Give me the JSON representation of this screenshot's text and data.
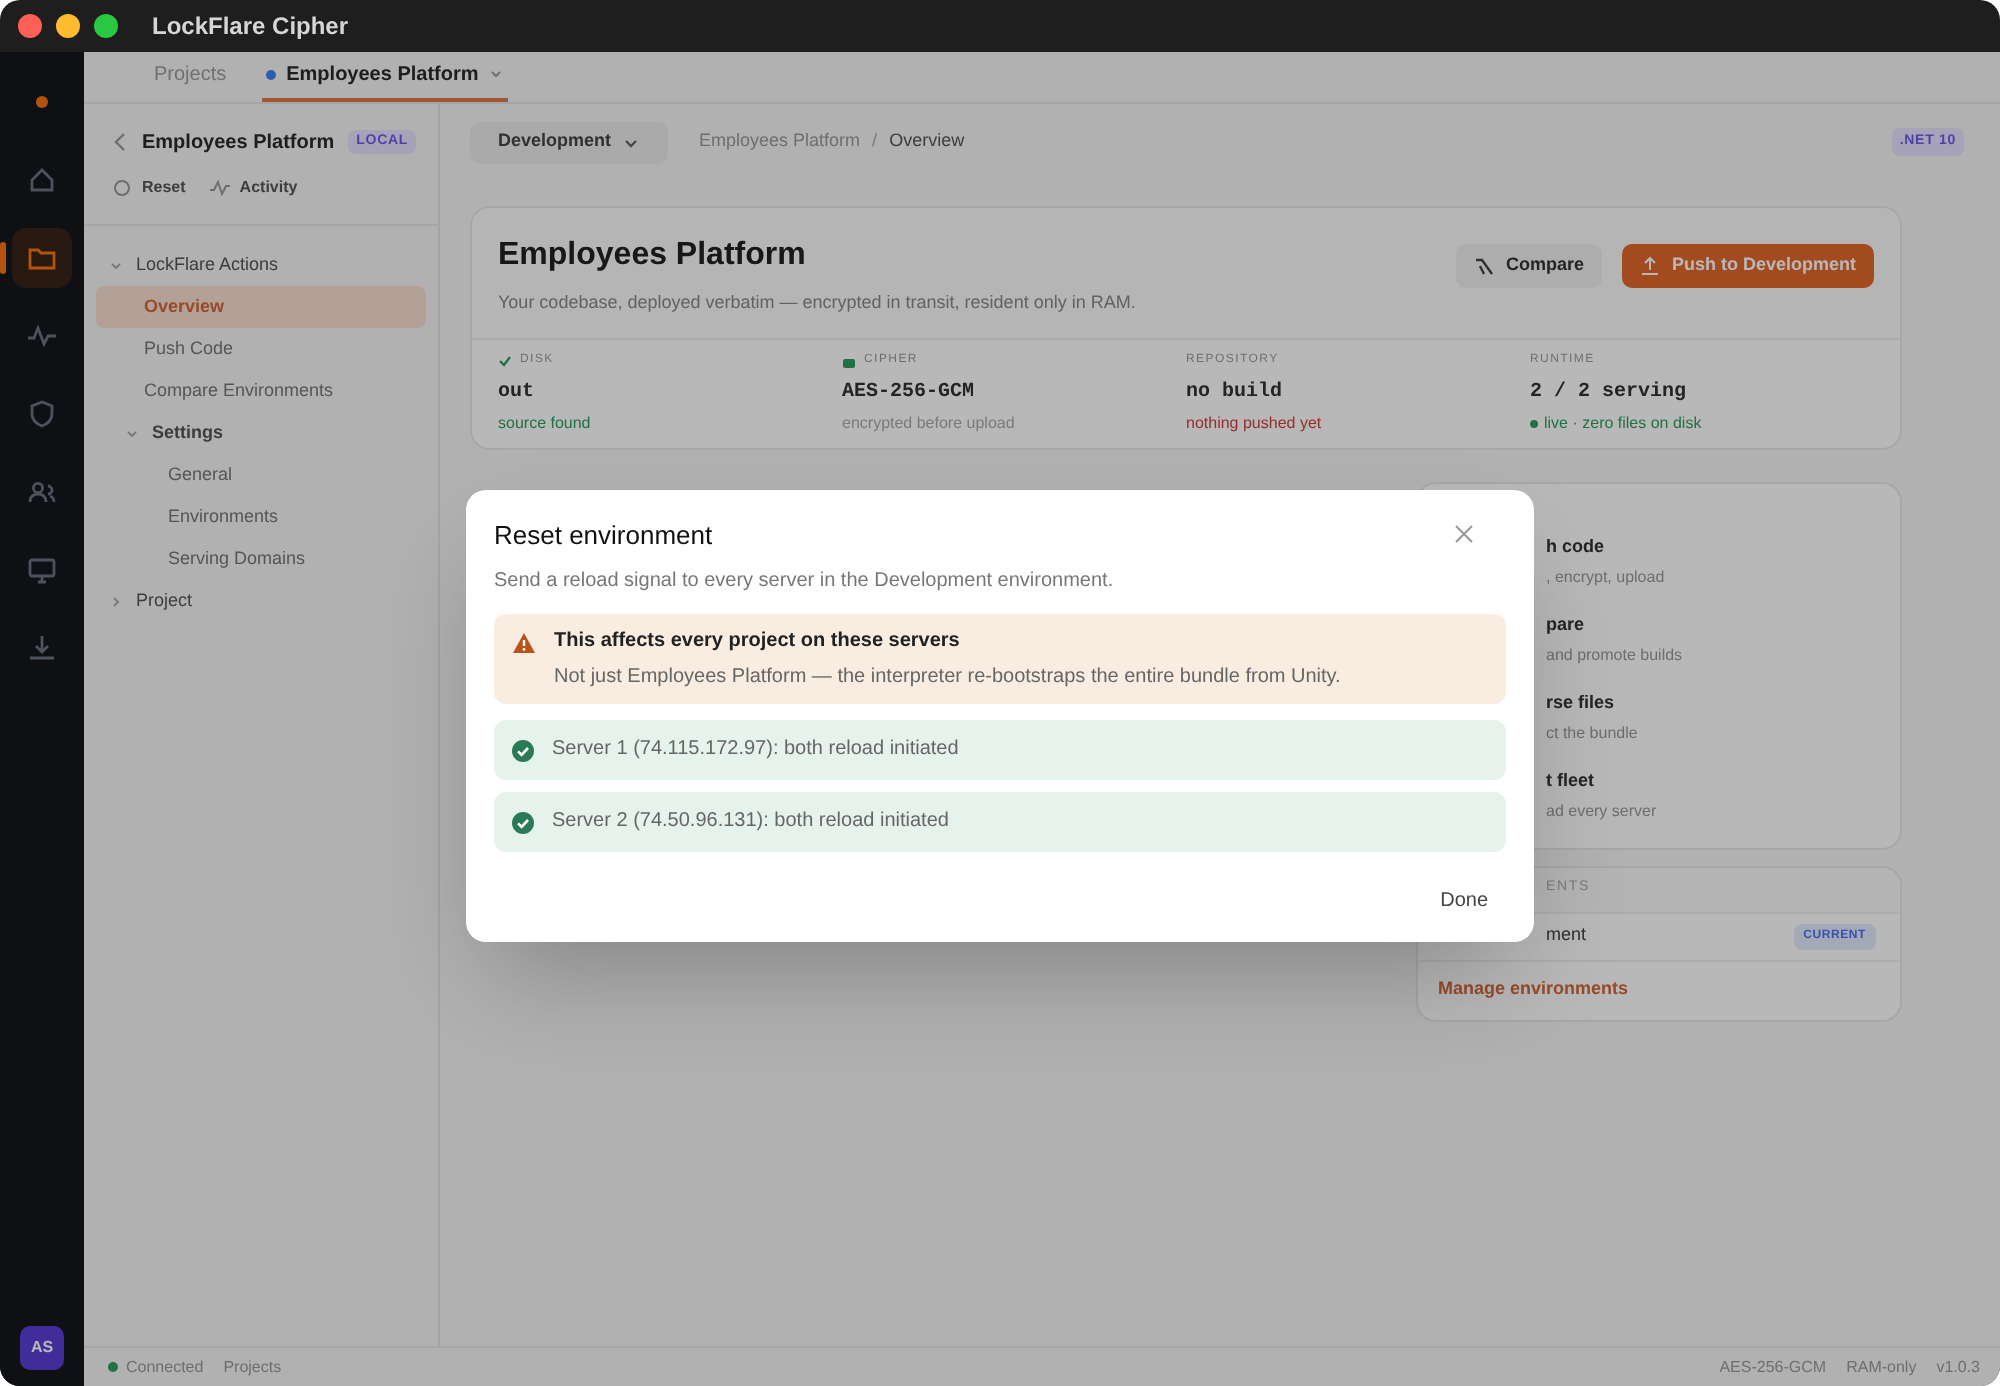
{
  "window": {
    "title": "LockFlare Cipher"
  },
  "rail_items": [
    {
      "selected": false
    },
    {
      "selected": false
    },
    {
      "selected": true
    },
    {
      "selected": false
    },
    {
      "selected": false
    },
    {
      "selected": false
    },
    {
      "selected": false
    },
    {
      "selected": false
    }
  ],
  "avatar": "AS",
  "tabs": [
    {
      "label": "Projects",
      "selected": false
    },
    {
      "label": "Employees Platform",
      "selected": true
    }
  ],
  "sidebar": {
    "title": "Employees Platform",
    "badge": "LOCAL",
    "actions": [
      "Reset",
      "Activity"
    ],
    "tree": [
      {
        "label": "LockFlare Actions",
        "expanded": true,
        "children": [
          {
            "label": "Overview",
            "selected": true
          },
          {
            "label": "Push Code",
            "selected": false
          },
          {
            "label": "Compare Environments",
            "selected": false
          },
          {
            "label": "Settings",
            "expanded": true,
            "children": [
              {
                "label": "General",
                "selected": false
              },
              {
                "label": "Environments",
                "selected": false
              },
              {
                "label": "Serving Domains",
                "selected": false
              }
            ]
          }
        ]
      },
      {
        "label": "Project",
        "expanded": false
      }
    ]
  },
  "topbar": {
    "environment": "Development",
    "breadcrumb": [
      "Employees Platform",
      "Overview"
    ],
    "breadcrumb_separator": "/",
    "badge": ".NET 10"
  },
  "header": {
    "title": "Employees Platform",
    "subtitle": "Your codebase, deployed verbatim — encrypted in transit, resident only in RAM.",
    "buttons": [
      {
        "label": "Compare",
        "kind": "secondary"
      },
      {
        "label": "Push to Development",
        "kind": "primary"
      }
    ]
  },
  "stats": [
    {
      "label": "DISK",
      "value": "out",
      "note": "source found",
      "kind": "found"
    },
    {
      "label": "CIPHER",
      "value": "AES-256-GCM",
      "note": "encrypted before upload",
      "kind": "encrypted"
    },
    {
      "label": "REPOSITORY",
      "value": "no build",
      "note": "nothing pushed yet",
      "kind": "missing"
    },
    {
      "label": "RUNTIME",
      "value": "2 / 2 serving",
      "note": "live · zero files on disk",
      "kind": "live"
    }
  ],
  "actions_panel": [
    {
      "title": "h code",
      "note": ", encrypt, upload"
    },
    {
      "title": "pare",
      "note": "and promote builds"
    },
    {
      "title": "rse files",
      "note": "ct the bundle"
    },
    {
      "title": "t fleet",
      "note": "ad every server"
    }
  ],
  "environments_panel": {
    "header": "ENTS",
    "rows": [
      {
        "name": "ment",
        "badge": "CURRENT"
      }
    ],
    "link": "Manage environments"
  },
  "status_bar": {
    "connection": "Connected",
    "connected": true,
    "left": [
      "Projects"
    ],
    "right": [
      "AES-256-GCM",
      "RAM-only",
      "v1.0.3"
    ]
  },
  "dialog": {
    "title": "Reset environment",
    "description": "Send a reload signal to every server in the Development environment.",
    "warning": {
      "title": "This affects every project on these servers",
      "body": "Not just Employees Platform — the interpreter re-bootstraps the entire bundle from Unity."
    },
    "results": [
      {
        "text": "Server 1 (74.115.172.97): both reload initiated",
        "kind": "success"
      },
      {
        "text": "Server 2 (74.50.96.131): both reload initiated",
        "kind": "success"
      }
    ],
    "button": "Done"
  }
}
